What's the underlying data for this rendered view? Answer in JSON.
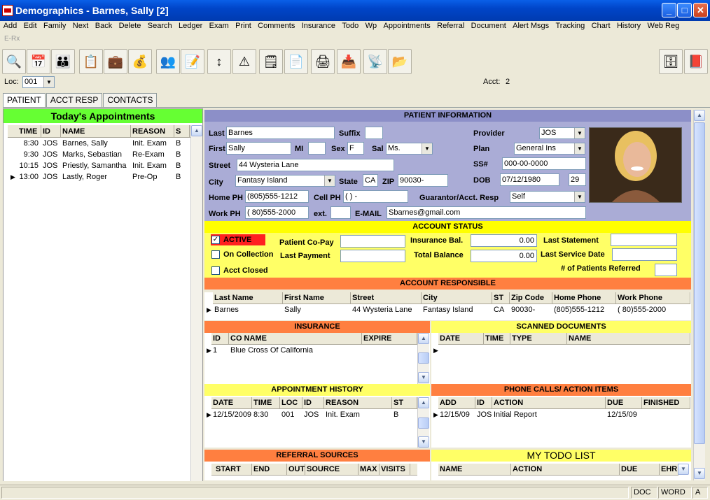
{
  "window": {
    "title": "Demographics - Barnes, Sally [2]",
    "minimize": "_",
    "maximize": "□",
    "close": "✕"
  },
  "menu": [
    "Add",
    "Edit",
    "Family",
    "Next",
    "Back",
    "Delete",
    "Search",
    "Ledger",
    "Exam",
    "Print",
    "Comments",
    "Insurance",
    "Todo",
    "Wp",
    "Appointments",
    "Referral",
    "Document",
    "Alert Msgs",
    "Tracking",
    "Chart",
    "History",
    "Web Reg"
  ],
  "erx": "E-Rx",
  "toolbar_icons": [
    "search-icon",
    "calendar-icon",
    "family-icon",
    "checklist-icon",
    "medical-bag-icon",
    "money-bag-icon",
    "group-icon",
    "clipboard-icon",
    "arrows-icon",
    "warning-icon",
    "note-icon",
    "document-icon",
    "scanner-icon",
    "printer-tray-icon",
    "satellite-icon",
    "folders-icon",
    "cabinet-icon",
    "book-icon"
  ],
  "loc": {
    "label": "Loc:",
    "value": "001",
    "acct_label": "Acct:",
    "acct_value": "2"
  },
  "tabs": [
    "PATIENT",
    "ACCT RESP",
    "CONTACTS"
  ],
  "appointments": {
    "title": "Today's Appointments",
    "columns": [
      "TIME",
      "ID",
      "NAME",
      "REASON",
      "S"
    ],
    "rows": [
      [
        "8:30",
        "JOS",
        "Barnes, Sally",
        "Init. Exam",
        "B"
      ],
      [
        "9:30",
        "JOS",
        "Marks, Sebastian",
        "Re-Exam",
        "B"
      ],
      [
        "10:15",
        "JOS",
        "Priestly, Samantha",
        "Init. Exam",
        "B"
      ],
      [
        "13:00",
        "JOS",
        "Lastly, Roger",
        "Pre-Op",
        "B"
      ]
    ]
  },
  "patient": {
    "header": "PATIENT INFORMATION",
    "last_label": "Last",
    "last": "Barnes",
    "suffix_label": "Suffix",
    "suffix": "",
    "first_label": "First",
    "first": "Sally",
    "mi_label": "MI",
    "mi": "",
    "sex_label": "Sex",
    "sex": "F",
    "sal_label": "Sal",
    "sal": "Ms.",
    "street_label": "Street",
    "street": "44 Wysteria Lane",
    "city_label": "City",
    "city": "Fantasy Island",
    "state_label": "State",
    "state": "CA",
    "zip_label": "ZIP",
    "zip": "90030-",
    "home_label": "Home PH",
    "home": "(805)555-1212",
    "cell_label": "Cell PH",
    "cell": "(   )   -",
    "work_label": "Work PH",
    "work": "( 80)555-2000",
    "ext_label": "ext.",
    "ext": "",
    "email_label": "E-MAIL",
    "email": "Sbarnes@gmail.com",
    "provider_label": "Provider",
    "provider": "JOS",
    "plan_label": "Plan",
    "plan": "General Ins",
    "ss_label": "SS#",
    "ss": "000-00-0000",
    "dob_label": "DOB",
    "dob": "07/12/1980",
    "age": "29",
    "guar_label": "Guarantor/Acct. Resp",
    "guar": "Self"
  },
  "account": {
    "header": "ACCOUNT STATUS",
    "active": "ACTIVE",
    "on_collection": "On Collection",
    "acct_closed": "Acct Closed",
    "copay_label": "Patient Co-Pay",
    "copay": "",
    "last_payment_label": "Last Payment",
    "last_payment": "",
    "ins_bal_label": "Insurance Bal.",
    "ins_bal": "0.00",
    "total_bal_label": "Total Balance",
    "total_bal": "0.00",
    "last_stmt_label": "Last Statement",
    "last_stmt": "",
    "last_svc_label": "Last Service Date",
    "last_svc": "",
    "referred_label": "# of Patients Referred",
    "referred": ""
  },
  "acct_resp": {
    "header": "ACCOUNT RESPONSIBLE",
    "columns": [
      "Last Name",
      "First Name",
      "Street",
      "City",
      "ST",
      "Zip Code",
      "Home Phone",
      "Work Phone"
    ],
    "rows": [
      [
        "Barnes",
        "Sally",
        "44 Wysteria Lane",
        "Fantasy Island",
        "CA",
        "90030-",
        "(805)555-1212",
        "( 80)555-2000"
      ]
    ]
  },
  "insurance": {
    "header": "INSURANCE",
    "columns": [
      "ID",
      "CO NAME",
      "EXPIRE"
    ],
    "rows": [
      [
        "1",
        "Blue Cross Of California",
        ""
      ]
    ]
  },
  "scanned": {
    "header": "SCANNED DOCUMENTS",
    "columns": [
      "DATE",
      "TIME",
      "TYPE",
      "NAME"
    ]
  },
  "appt_history": {
    "header": "APPOINTMENT HISTORY",
    "columns": [
      "DATE",
      "TIME",
      "LOC",
      "ID",
      "REASON",
      "ST"
    ],
    "rows": [
      [
        "12/15/2009",
        "8:30",
        "001",
        "JOS",
        "Init. Exam",
        "B"
      ]
    ]
  },
  "phone_calls": {
    "header": "PHONE CALLS/ ACTION ITEMS",
    "columns": [
      "ADD",
      "ID",
      "ACTION",
      "DUE",
      "FINISHED"
    ],
    "rows": [
      [
        "12/15/09",
        "JOS",
        "Initial Report",
        "12/15/09",
        ""
      ]
    ]
  },
  "referral": {
    "header": "REFERRAL SOURCES",
    "columns": [
      "START",
      "END",
      "OUT",
      "SOURCE",
      "MAX",
      "VISITS"
    ]
  },
  "todo": {
    "header": "MY TODO LIST",
    "columns": [
      "NAME",
      "ACTION",
      "DUE",
      "EHR"
    ]
  },
  "status": {
    "doc": "DOC",
    "word": "WORD",
    "a": "A"
  },
  "colors": {
    "title_blue": "#0045c8",
    "green": "#66ff33",
    "lavender": "#aaacd6",
    "yellow": "#ffff66",
    "orange": "#ff7f40",
    "red": "#ff2020"
  }
}
